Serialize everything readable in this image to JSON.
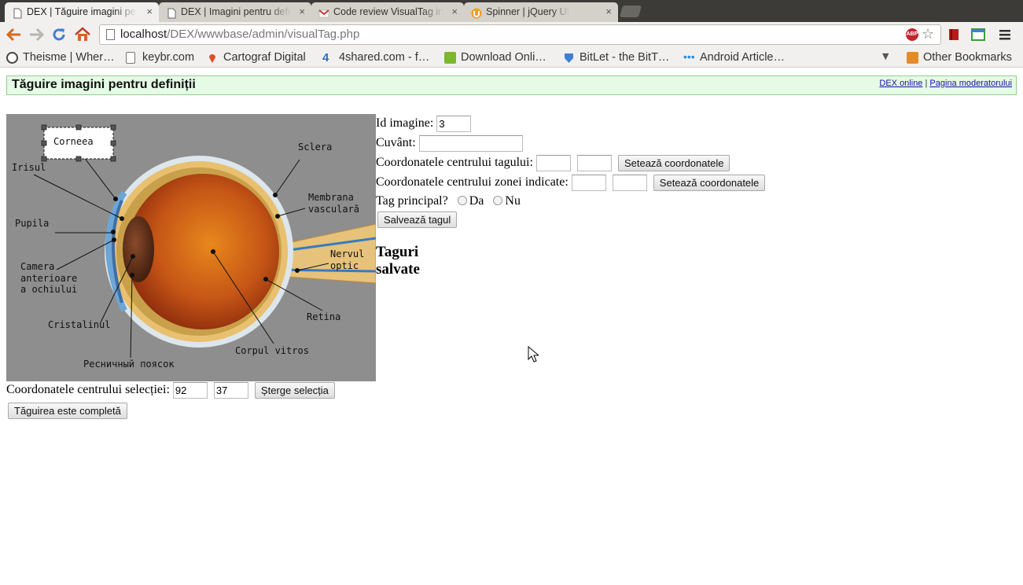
{
  "browser": {
    "tabs": [
      {
        "title": "DEX | Tăguire imagini pentru definiții",
        "active": true
      },
      {
        "title": "DEX | Imagini pentru definiții",
        "active": false
      },
      {
        "title": "Code review VisualTag info",
        "active": false
      },
      {
        "title": "Spinner | jQuery UI",
        "active": false
      }
    ],
    "tab_close": "×",
    "url_host": "localhost",
    "url_path": "/DEX/wwwbase/admin/visualTag.php",
    "abp_label": "ABP",
    "bookmarks": [
      {
        "label": "Theisme | Wher…",
        "icon": "wordpress-icon"
      },
      {
        "label": "keybr.com",
        "icon": "page-icon"
      },
      {
        "label": "Cartograf Digital",
        "icon": "map-pin-icon"
      },
      {
        "label": "4shared.com - f…",
        "icon": "4shared-icon"
      },
      {
        "label": "Download Onli…",
        "icon": "download-icon"
      },
      {
        "label": "BitLet - the BitT…",
        "icon": "bitlet-icon"
      },
      {
        "label": "Android Article…",
        "icon": "dots-icon"
      }
    ],
    "other_bookmarks": "Other Bookmarks"
  },
  "page": {
    "title": "Tăguire imagini pentru definiții",
    "link_dex": "DEX online",
    "link_separator": "|",
    "link_moderator": "Pagina moderatorului",
    "image_labels": {
      "corneea": "Corneea",
      "irisul": "Irisul",
      "pupila": "Pupila",
      "camera_1": "Camera",
      "camera_2": "anterioare",
      "camera_3": "a ochiului",
      "cristalinul": "Cristalinul",
      "resnichnyi": "Ресничный поясок",
      "sclera": "Sclera",
      "membrana_1": "Membrana",
      "membrana_2": "vasculară",
      "nervul_1": "Nervul",
      "nervul_2": "optic",
      "retina": "Retina",
      "corpul": "Corpul vitros"
    },
    "form": {
      "image_id_label": "Id imagine:",
      "image_id_value": "3",
      "word_label": "Cuvânt:",
      "word_value": "",
      "tag_center_label": "Coordonatele centrului tagului:",
      "tag_center_x": "",
      "tag_center_y": "",
      "set_coords_button": "Setează coordonatele",
      "zone_center_label": "Coordonatele centrului zonei indicate:",
      "zone_center_x": "",
      "zone_center_y": "",
      "main_tag_label": "Tag principal?",
      "option_yes": "Da",
      "option_no": "Nu",
      "save_tag_button": "Salvează tagul",
      "saved_tags_heading": "Taguri salvate"
    },
    "selection": {
      "label": "Coordonatele centrului selecției:",
      "x": "92",
      "y": "37",
      "clear_button": "Șterge selecția"
    },
    "complete_button": "Tăguirea este completă"
  }
}
